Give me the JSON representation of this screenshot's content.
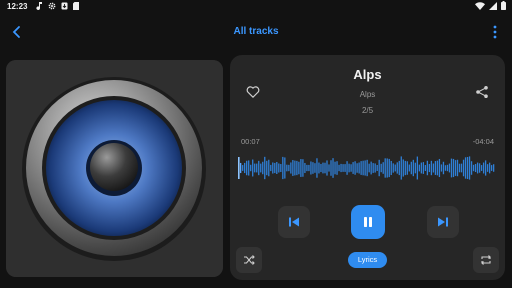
{
  "statusbar": {
    "time": "12:23"
  },
  "appbar": {
    "title": "All tracks"
  },
  "track": {
    "title": "Alps",
    "artist": "Alps",
    "index": "2/5"
  },
  "progress": {
    "elapsed": "00:07",
    "remaining": "-04:04"
  },
  "buttons": {
    "lyrics_label": "Lyrics"
  },
  "icons": {
    "back": "back-arrow-icon",
    "menu": "more-vertical-icon",
    "favorite": "heart-outline-icon",
    "share": "share-icon",
    "previous": "skip-previous-icon",
    "play_pause": "pause-icon",
    "next": "skip-next-icon",
    "shuffle": "shuffle-icon",
    "repeat": "repeat-icon"
  },
  "colors": {
    "accent": "#2f8cf0",
    "title_accent": "#3b97ff",
    "card": "#262626",
    "background": "#121212"
  }
}
